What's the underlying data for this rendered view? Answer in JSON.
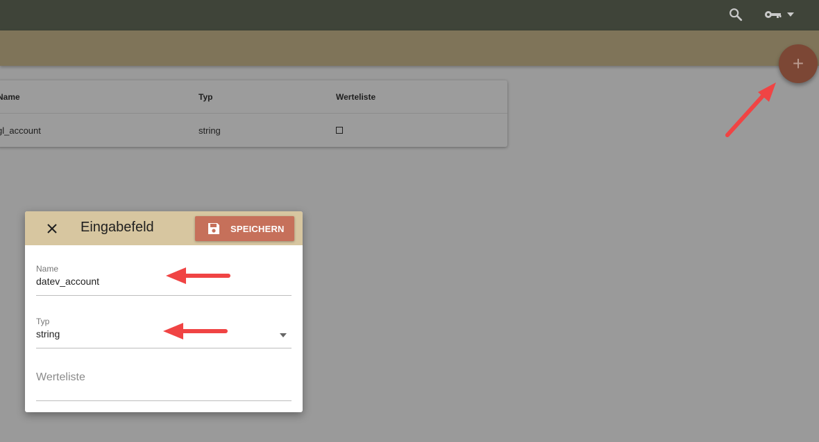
{
  "colors": {
    "topbar": "#3f4439",
    "subbar": "#7f7459",
    "fab": "#7c4735",
    "dialog_header": "#d7c6a0",
    "save_button": "#c6705a",
    "annotation_arrow": "#f04444"
  },
  "topbar": {
    "search_icon": "search-icon",
    "user_icon": "key-icon",
    "user_dropdown_icon": "caret-down-icon"
  },
  "fab": {
    "label": "+"
  },
  "table": {
    "columns": [
      "Name",
      "Typ",
      "Werteliste"
    ],
    "rows": [
      {
        "name": "gl_account",
        "typ": "string",
        "werteliste": "unchecked"
      }
    ]
  },
  "dialog": {
    "title": "Eingabefeld",
    "close_icon": "close-icon",
    "save_label": "SPEICHERN",
    "save_icon": "floppy-disk-icon",
    "fields": {
      "name": {
        "label": "Name",
        "value": "datev_account"
      },
      "typ": {
        "label": "Typ",
        "value": "string"
      },
      "werteliste": {
        "placeholder": "Werteliste"
      }
    }
  }
}
